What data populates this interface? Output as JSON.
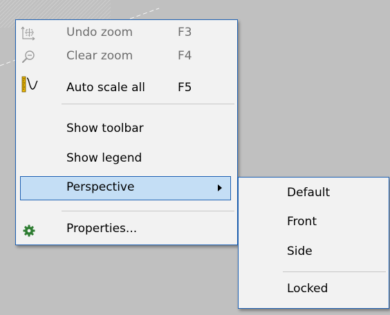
{
  "context_menu": {
    "items": [
      {
        "label": "Undo zoom",
        "accel": "F3",
        "icon": "undo-zoom-icon",
        "disabled": true
      },
      {
        "label": "Clear zoom",
        "accel": "F4",
        "icon": "clear-zoom-icon",
        "disabled": true
      },
      {
        "label": "Auto scale all",
        "accel": "F5",
        "icon": "auto-scale-icon",
        "disabled": false
      }
    ],
    "view_items": [
      {
        "label": "Show toolbar"
      },
      {
        "label": "Show legend"
      }
    ],
    "perspective": {
      "label": "Perspective",
      "highlighted": true
    },
    "properties": {
      "label": "Properties...",
      "icon": "gear-icon"
    }
  },
  "perspective_submenu": {
    "items": [
      {
        "label": "Default"
      },
      {
        "label": "Front"
      },
      {
        "label": "Side"
      }
    ],
    "locked": {
      "label": "Locked"
    }
  },
  "colors": {
    "menu_bg": "#f2f2f2",
    "menu_border": "#1c5fb2",
    "highlight_bg": "#c4def5",
    "disabled_text": "#6d6d6d",
    "canvas_bg": "#c0c0c0",
    "gear_green": "#2e7d32",
    "ruler_yellow": "#e8b400"
  }
}
